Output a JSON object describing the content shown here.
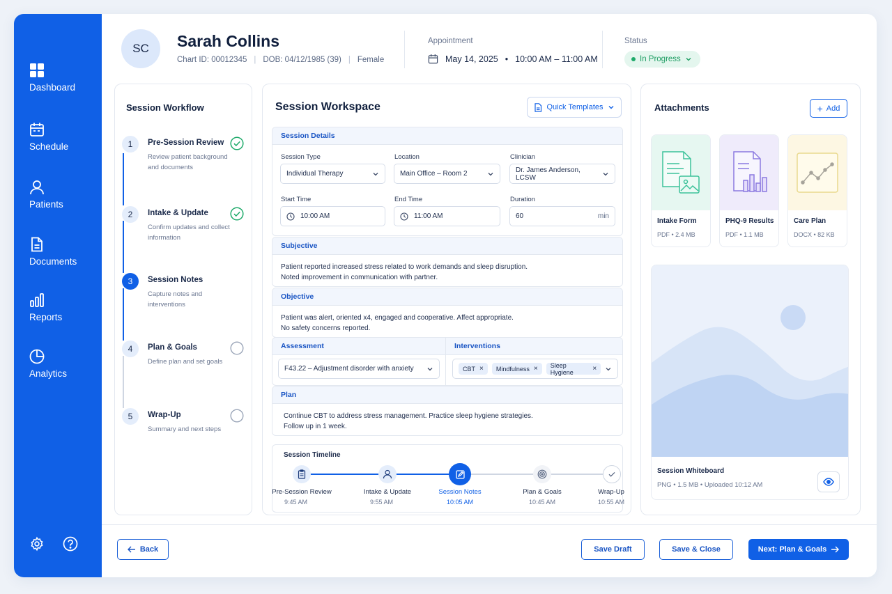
{
  "sidebar": {
    "items": [
      {
        "label": "Dashboard",
        "icon": "grid-icon"
      },
      {
        "label": "Schedule",
        "icon": "calendar-icon"
      },
      {
        "label": "Patients",
        "icon": "user-icon"
      },
      {
        "label": "Documents",
        "icon": "document-icon"
      },
      {
        "label": "Reports",
        "icon": "bar-chart-icon"
      },
      {
        "label": "Analytics",
        "icon": "pie-chart-icon"
      }
    ]
  },
  "patient": {
    "initials": "SC",
    "name": "Sarah Collins",
    "chart_id": "Chart ID: 00012345",
    "dob": "DOB: 04/12/1985 (39)",
    "gender": "Female"
  },
  "appointment": {
    "label": "Appointment",
    "date": "May 14, 2025",
    "time": "10:00 AM – 11:00 AM"
  },
  "status": {
    "label": "Status",
    "value": "In Progress"
  },
  "workflow": {
    "title": "Session Workflow",
    "steps": [
      {
        "num": "1",
        "title": "Pre-Session Review",
        "desc": "Review patient background and documents",
        "state": "done"
      },
      {
        "num": "2",
        "title": "Intake & Update",
        "desc": "Confirm updates and collect information",
        "state": "done"
      },
      {
        "num": "3",
        "title": "Session Notes",
        "desc": "Capture notes and interventions",
        "state": "active"
      },
      {
        "num": "4",
        "title": "Plan & Goals",
        "desc": "Define plan and set goals",
        "state": "pending"
      },
      {
        "num": "5",
        "title": "Wrap-Up",
        "desc": "Summary and next steps",
        "state": "pending"
      }
    ]
  },
  "workspace": {
    "title": "Session Workspace",
    "quick_templates": "Quick Templates",
    "details": {
      "header": "Session Details",
      "session_type_label": "Session Type",
      "session_type": "Individual Therapy",
      "location_label": "Location",
      "location": "Main Office – Room 2",
      "clinician_label": "Clinician",
      "clinician": "Dr. James Anderson, LCSW",
      "start_label": "Start Time",
      "start": "10:00 AM",
      "end_label": "End Time",
      "end": "11:00 AM",
      "duration_label": "Duration",
      "duration": "60",
      "duration_unit": "min"
    },
    "subjective": {
      "header": "Subjective",
      "line1": "Patient reported increased stress related to work demands and sleep disruption.",
      "line2": "Noted improvement in communication with partner."
    },
    "objective": {
      "header": "Objective",
      "line1": "Patient was alert, oriented x4, engaged and cooperative. Affect appropriate.",
      "line2": "No safety concerns reported."
    },
    "assessment": {
      "header": "Assessment",
      "value": "F43.22 – Adjustment disorder with anxiety"
    },
    "interventions": {
      "header": "Interventions",
      "chips": [
        "CBT",
        "Mindfulness",
        "Sleep Hygiene"
      ]
    },
    "plan": {
      "header": "Plan",
      "line1": "Continue CBT to address stress management. Practice sleep hygiene strategies.",
      "line2": "Follow up in 1 week."
    },
    "timeline": {
      "title": "Session Timeline",
      "nodes": [
        {
          "label": "Pre-Session Review",
          "time": "9:45 AM"
        },
        {
          "label": "Intake & Update",
          "time": "9:55 AM"
        },
        {
          "label": "Session Notes",
          "time": "10:05 AM"
        },
        {
          "label": "Plan & Goals",
          "time": "10:45 AM"
        },
        {
          "label": "Wrap-Up",
          "time": "10:55 AM"
        }
      ]
    }
  },
  "attachments": {
    "title": "Attachments",
    "add_label": "Add",
    "files": [
      {
        "name": "Intake Form",
        "meta": "PDF  •  2.4 MB"
      },
      {
        "name": "PHQ-9 Results",
        "meta": "PDF  •  1.1 MB"
      },
      {
        "name": "Care Plan",
        "meta": "DOCX  •  82 KB"
      }
    ],
    "whiteboard": {
      "name": "Session Whiteboard",
      "meta": "PNG  •  1.5 MB  •  Uploaded 10:12 AM"
    }
  },
  "footer": {
    "back": "Back",
    "save_draft": "Save Draft",
    "save_close": "Save & Close",
    "next": "Next: Plan & Goals"
  },
  "colors": {
    "primary": "#1060e6",
    "success": "#1eaa6a",
    "accent_light": "#e4edfb"
  }
}
